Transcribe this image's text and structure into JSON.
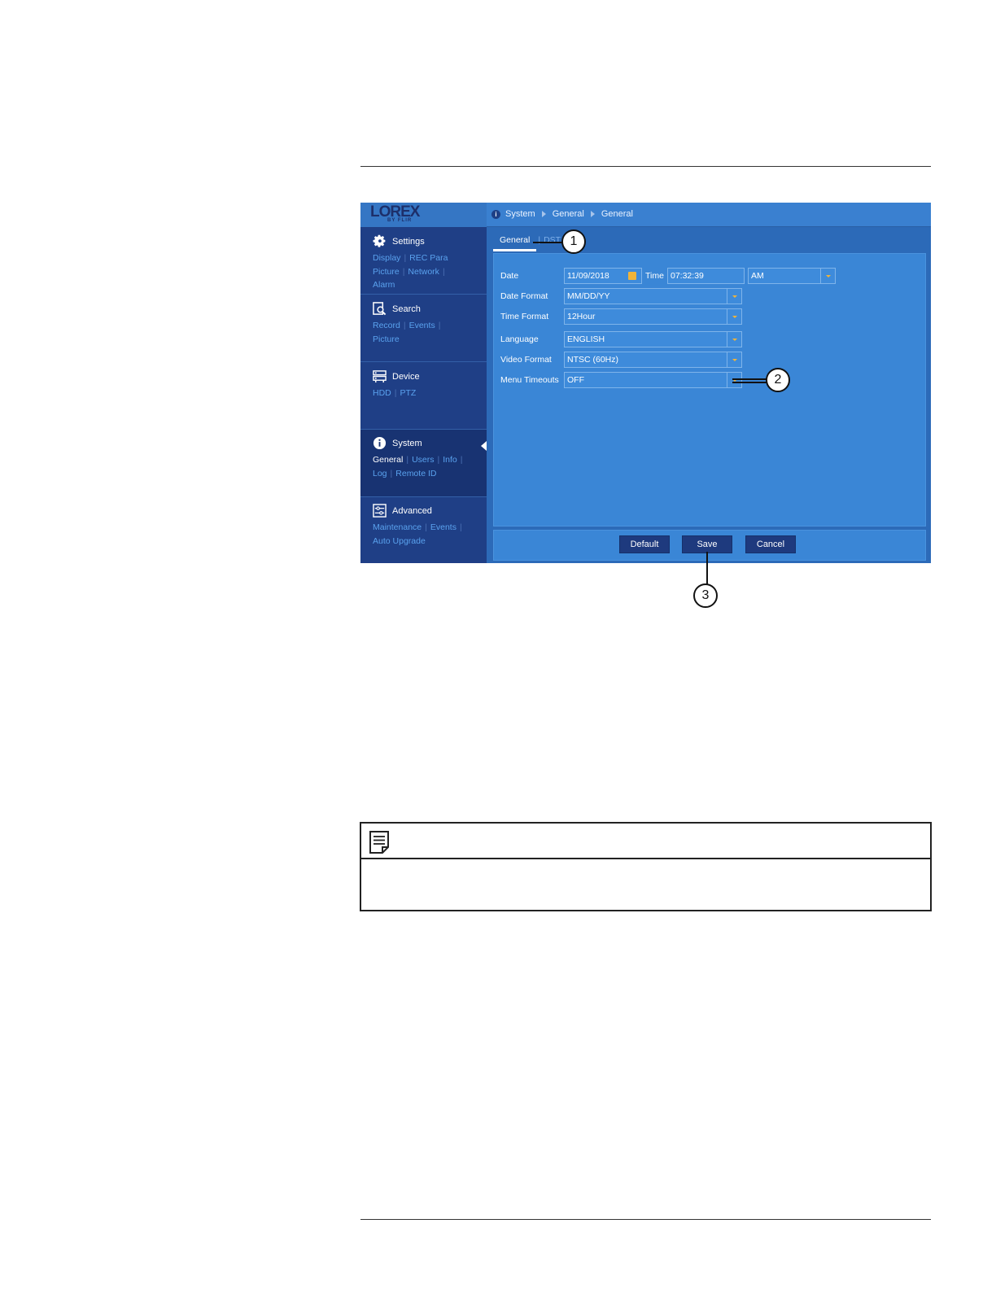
{
  "dvr": {
    "logo": {
      "brand": "LOREX",
      "sub": "BY FLIR"
    },
    "breadcrumb": [
      "System",
      "General",
      "General"
    ],
    "sidebar": [
      {
        "title": "Settings",
        "icon": "gear-icon",
        "links": [
          "Display",
          "REC Para",
          "Picture",
          "Network",
          "Alarm"
        ]
      },
      {
        "title": "Search",
        "icon": "search-icon",
        "links": [
          "Record",
          "Events",
          "Picture"
        ]
      },
      {
        "title": "Device",
        "icon": "device-icon",
        "links": [
          "HDD",
          "PTZ"
        ]
      },
      {
        "title": "System",
        "icon": "info-icon",
        "links": [
          "General",
          "Users",
          "Info",
          "Log",
          "Remote ID"
        ],
        "active": true
      },
      {
        "title": "Advanced",
        "icon": "sliders-icon",
        "links": [
          "Maintenance",
          "Events",
          "Auto Upgrade"
        ]
      }
    ],
    "tabs": {
      "general": "General",
      "dst": "DST"
    },
    "form": {
      "date_label": "Date",
      "date_value": "11/09/2018",
      "time_label": "Time",
      "time_value": "07:32:39",
      "ampm_value": "AM",
      "date_format_label": "Date Format",
      "date_format_value": "MM/DD/YY",
      "time_format_label": "Time Format",
      "time_format_value": "12Hour",
      "language_label": "Language",
      "language_value": "ENGLISH",
      "video_format_label": "Video Format",
      "video_format_value": "NTSC (60Hz)",
      "menu_timeouts_label": "Menu Timeouts",
      "menu_timeouts_value": "OFF"
    },
    "buttons": {
      "default": "Default",
      "save": "Save",
      "cancel": "Cancel"
    }
  },
  "callouts": {
    "one": "1",
    "two": "2",
    "three": "3"
  },
  "colors": {
    "accent_orange": "#f0b43a",
    "sidebar_bg": "#1f3f86",
    "panel_bg": "#3a86d6"
  }
}
